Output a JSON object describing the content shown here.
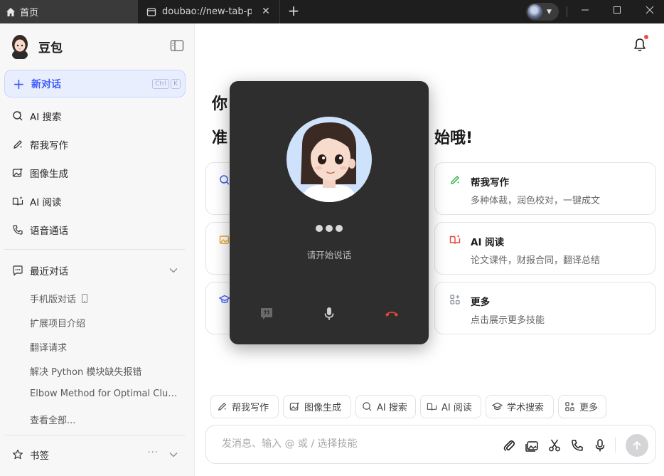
{
  "browser": {
    "tabs": [
      {
        "label": "首页",
        "icon": "home-icon"
      },
      {
        "label": "doubao://new-tab-page",
        "icon": "page-icon"
      }
    ],
    "new_tab": "+",
    "window_controls": [
      "minimize",
      "maximize",
      "close"
    ]
  },
  "sidebar": {
    "brand": "豆包",
    "new_chat": {
      "label": "新对话",
      "keys": [
        "Ctrl",
        "K"
      ]
    },
    "nav": [
      {
        "label": "AI 搜索",
        "icon": "ai-search-icon"
      },
      {
        "label": "帮我写作",
        "icon": "pen-icon"
      },
      {
        "label": "图像生成",
        "icon": "image-gen-icon"
      },
      {
        "label": "AI 阅读",
        "icon": "book-icon"
      },
      {
        "label": "语音通话",
        "icon": "phone-icon"
      }
    ],
    "recent": {
      "title": "最近对话",
      "items": [
        "手机版对话",
        "扩展项目介绍",
        "翻译请求",
        "解决 Python 模块缺失报错",
        "Elbow Method for Optimal Clusters",
        "查看全部..."
      ]
    },
    "bookmarks": {
      "title": "书签",
      "more": "···"
    }
  },
  "main": {
    "greeting_line1": "你",
    "greeting_line2": "准                                      始哦!",
    "cards": [
      {
        "title": "帮我写作",
        "desc": "多种体裁，润色校对，一键成文",
        "icon": "pen-icon",
        "color": "#39b54a"
      },
      {
        "title": "AI 阅读",
        "desc": "论文课件，财报合同，翻译总结",
        "icon": "book-icon",
        "color": "#e6453c"
      },
      {
        "title": "更多",
        "desc": "点击展示更多技能",
        "icon": "grid-icon",
        "color": "#8a8f99"
      }
    ],
    "chips": [
      {
        "label": "帮我写作",
        "icon": "pen-icon"
      },
      {
        "label": "图像生成",
        "icon": "image-gen-icon"
      },
      {
        "label": "AI 搜索",
        "icon": "ai-search-icon"
      },
      {
        "label": "AI 阅读",
        "icon": "book-icon"
      },
      {
        "label": "学术搜索",
        "icon": "academic-icon"
      },
      {
        "label": "更多",
        "icon": "grid-icon"
      }
    ],
    "input": {
      "placeholder": "发消息、输入 @ 或 / 选择技能"
    }
  },
  "call": {
    "status": "请开始说话",
    "buttons": [
      "subtitle-icon",
      "microphone-icon",
      "hang-up-icon"
    ]
  },
  "colors": {
    "accent": "#3b5bfd",
    "accent_bg": "#e9eeff",
    "call_bg": "#2e2e2e",
    "hangup": "#e6453c"
  }
}
